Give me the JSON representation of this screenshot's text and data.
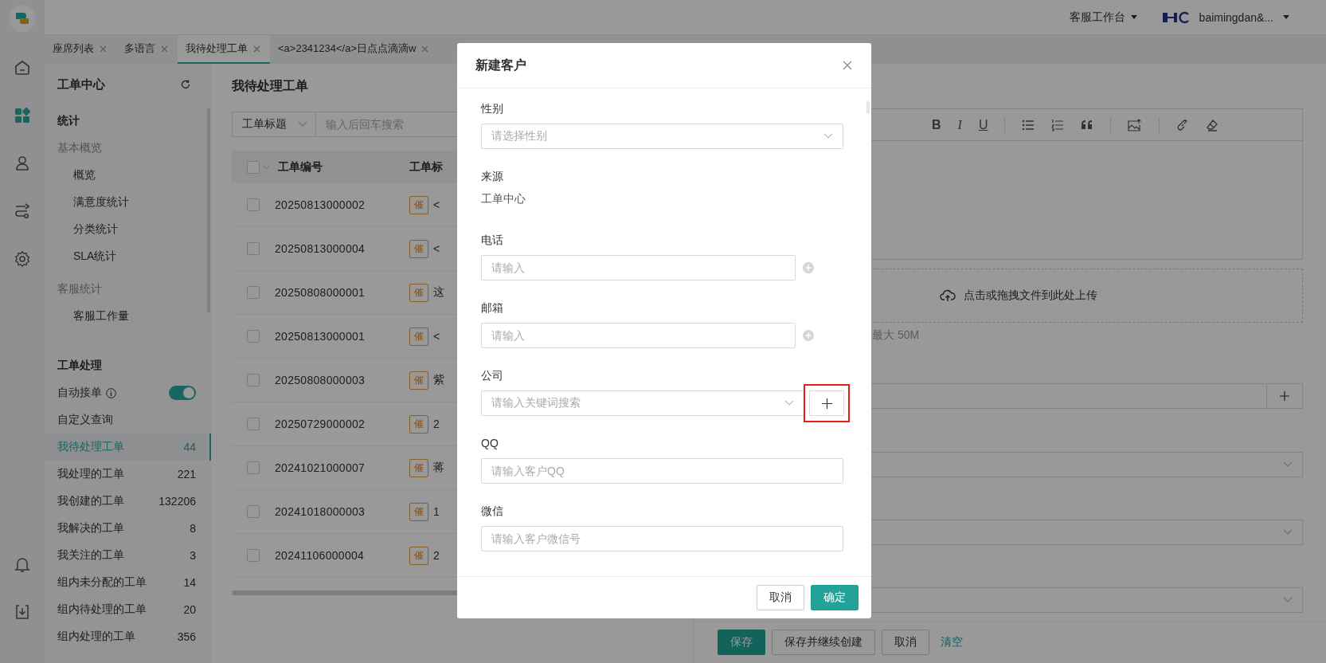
{
  "top_bar": {
    "workspace": "客服工作台",
    "user": "baimingdan&..."
  },
  "nav_rail": {
    "top": [
      {
        "kind": "home",
        "selected": false
      },
      {
        "kind": "apps",
        "selected": true
      },
      {
        "kind": "person",
        "selected": false
      },
      {
        "kind": "flow",
        "selected": false
      },
      {
        "kind": "settings",
        "selected": false
      }
    ],
    "bottom": [
      {
        "kind": "bell",
        "selected": false
      },
      {
        "kind": "download",
        "selected": false
      }
    ]
  },
  "tabs": [
    {
      "label": "座席列表",
      "selected": false
    },
    {
      "label": "多语言",
      "selected": false
    },
    {
      "label": "我待处理工单",
      "selected": true
    },
    {
      "label": "<a>2341234</a>日点点滴滴w",
      "selected": false
    }
  ],
  "sidebar": {
    "title": "工单中心",
    "stats": {
      "heading": "统计",
      "groups": [
        {
          "label": "基本概览",
          "items": [
            "概览",
            "满意度统计",
            "分类统计",
            "SLA统计"
          ]
        },
        {
          "label": "客服统计",
          "items": [
            "客服工作量"
          ]
        }
      ]
    },
    "processing": {
      "heading": "工单处理",
      "items": [
        {
          "kind": "toggle",
          "label": "自动接单",
          "on": true,
          "selected": false
        },
        {
          "kind": "link",
          "label": "自定义查询",
          "selected": false
        },
        {
          "kind": "count",
          "label": "我待处理工单",
          "count": "44",
          "selected": true
        },
        {
          "kind": "count",
          "label": "我处理的工单",
          "count": "221",
          "selected": false
        },
        {
          "kind": "count",
          "label": "我创建的工单",
          "count": "132206",
          "selected": false
        },
        {
          "kind": "count",
          "label": "我解决的工单",
          "count": "8",
          "selected": false
        },
        {
          "kind": "count",
          "label": "我关注的工单",
          "count": "3",
          "selected": false
        },
        {
          "kind": "count",
          "label": "组内未分配的工单",
          "count": "14",
          "selected": false
        },
        {
          "kind": "count",
          "label": "组内待处理的工单",
          "count": "20",
          "selected": false
        },
        {
          "kind": "count",
          "label": "组内处理的工单",
          "count": "356",
          "selected": false
        }
      ]
    }
  },
  "list": {
    "title": "我待处理工单",
    "select_all": false,
    "filter": {
      "field": "工单标题",
      "placeholder": "输入后回车搜索"
    },
    "columns": [
      "工单编号",
      "工单标"
    ],
    "rows": [
      {
        "id": "20250813000002",
        "tag": "催",
        "title": "<",
        "checked": false
      },
      {
        "id": "20250813000004",
        "tag": "催",
        "title": "<",
        "checked": false
      },
      {
        "id": "20250808000001",
        "tag": "催",
        "title": "这",
        "checked": false
      },
      {
        "id": "20250813000001",
        "tag": "催",
        "title": "<",
        "checked": false
      },
      {
        "id": "20250808000003",
        "tag": "催",
        "title": "紫",
        "checked": false
      },
      {
        "id": "20250729000002",
        "tag": "催",
        "title": "2",
        "checked": false
      },
      {
        "id": "20241021000007",
        "tag": "催",
        "title": "蒋",
        "checked": false
      },
      {
        "id": "20241018000003",
        "tag": "催",
        "title": "1",
        "checked": false
      },
      {
        "id": "20241106000004",
        "tag": "催",
        "title": "2",
        "checked": false
      }
    ]
  },
  "form": {
    "toolbar": [
      {
        "kind": "text",
        "glyph": "B"
      },
      {
        "kind": "text",
        "glyph": "I"
      },
      {
        "kind": "text",
        "glyph": "U"
      },
      {
        "kind": "separator"
      },
      {
        "kind": "bullet-list"
      },
      {
        "kind": "numbered-list"
      },
      {
        "kind": "quote"
      },
      {
        "kind": "separator"
      },
      {
        "kind": "image"
      },
      {
        "kind": "separator"
      },
      {
        "kind": "link"
      },
      {
        "kind": "eraser"
      }
    ],
    "upload": {
      "text": "点击或拖拽文件到此处上传",
      "hint": "最大 50M"
    },
    "fields": [
      {
        "kind": "input-add"
      },
      {
        "kind": "select"
      },
      {
        "kind": "select"
      },
      {
        "kind": "select"
      }
    ],
    "actions": [
      {
        "label": "保存",
        "kind": "primary"
      },
      {
        "label": "保存并继续创建",
        "kind": "default"
      },
      {
        "label": "取消",
        "kind": "default"
      },
      {
        "label": "清空",
        "kind": "link"
      }
    ]
  },
  "modal": {
    "title": "新建客户",
    "fields": [
      {
        "label": "性别",
        "kind": "select",
        "placeholder": "请选择性别",
        "highlighted": false
      },
      {
        "label": "来源",
        "kind": "text",
        "value": "工单中心",
        "highlighted": false
      },
      {
        "label": "电话",
        "kind": "input-add",
        "placeholder": "请输入",
        "highlighted": false
      },
      {
        "label": "邮箱",
        "kind": "input-add",
        "placeholder": "请输入",
        "highlighted": false
      },
      {
        "label": "公司",
        "kind": "select-add",
        "placeholder": "请输入关键词搜索",
        "highlighted": true
      },
      {
        "label": "QQ",
        "kind": "input",
        "placeholder": "请输入客户QQ",
        "highlighted": false
      },
      {
        "label": "微信",
        "kind": "input",
        "placeholder": "请输入客户微信号",
        "highlighted": false
      }
    ],
    "buttons": [
      {
        "label": "取消",
        "kind": "default"
      },
      {
        "label": "确定",
        "kind": "primary"
      }
    ]
  }
}
